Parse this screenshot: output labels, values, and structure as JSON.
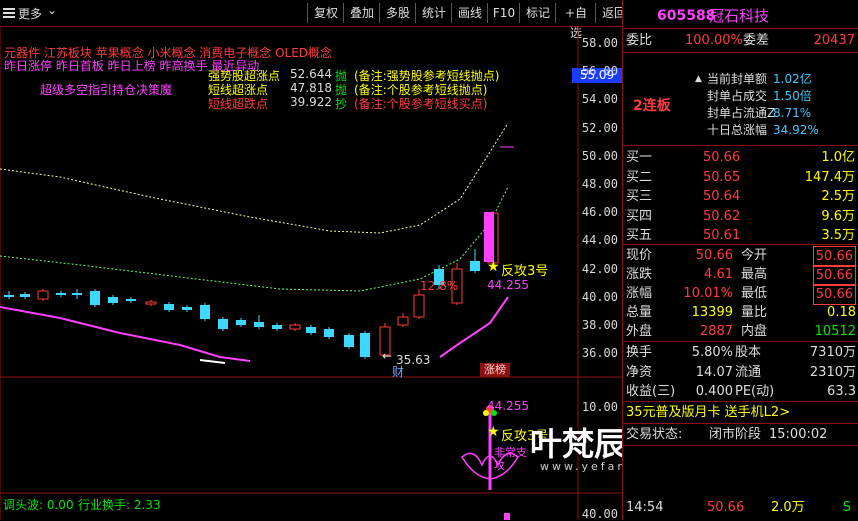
{
  "toolbar": {
    "menu_label": "更多",
    "buttons": [
      "复权",
      "叠加",
      "多股",
      "统计",
      "画线",
      "F10",
      "标记",
      "+自选",
      "返回"
    ]
  },
  "chart": {
    "concepts": "元器件  江苏板块  苹果概念 小米概念 消费电子概念 OLED概念",
    "flags": "昨日涨停 昨日首板 昨日上榜 昨高换手 最近异动",
    "indicator_title": "超级多空指引持仓决策魔",
    "legend": [
      {
        "name": "强势股超涨点",
        "value": "52.644",
        "tag": "抛",
        "note": "(备注:强势股参考短线抛点)",
        "color": "#ffff00"
      },
      {
        "name": "短线超涨点",
        "value": "47.818",
        "tag": "抛",
        "note": "(备注:个股参考短线抛点)",
        "color": "#ffff00"
      },
      {
        "name": "短线超跌点",
        "value": "39.922",
        "tag": "抄",
        "note": "(备注:个股参考短线买点)",
        "color": "#ff3c3c"
      }
    ],
    "y_axis": [
      "58.00",
      "56.00",
      "54.00",
      "52.00",
      "50.00",
      "48.00",
      "46.00",
      "44.00",
      "42.00",
      "40.00",
      "38.00",
      "36.00"
    ],
    "current_price_tag": "55.09",
    "low_marker": "35.63",
    "pct_label": "12.8%",
    "attack_label": "反攻3号",
    "value_label": "44.255",
    "finance_tag": "财",
    "rank_tag": "涨榜",
    "lower_y_axis": [
      "10.00",
      "40.00"
    ],
    "lower_value_label": "44.255",
    "lower_attack_label": "反攻3号",
    "lower_small_1": "非常支",
    "lower_small_2": "攻",
    "footer_left": "调头波: 0.00",
    "footer_right": "行业换手: 2.33",
    "watermark": "叶梵辰指标公式网",
    "watermark_url": "www.yefanchen.com"
  },
  "panel": {
    "code": "605588",
    "name": "冠石科技",
    "weibi_label": "委比",
    "weibi_value": "100.00%",
    "weicha_label": "委差",
    "weicha_value": "20437",
    "board_label": "2连板",
    "seal_stats": [
      {
        "label": "当前封单额",
        "value": "1.02亿"
      },
      {
        "label": "封单占成交",
        "value": "1.50倍"
      },
      {
        "label": "封单占流通Z",
        "value": "8.71%"
      },
      {
        "label": "十日总涨幅",
        "value": "34.92%"
      }
    ],
    "buy": [
      {
        "label": "买一",
        "price": "50.66",
        "vol": "1.0亿"
      },
      {
        "label": "买二",
        "price": "50.65",
        "vol": "147.4万"
      },
      {
        "label": "买三",
        "price": "50.64",
        "vol": "2.5万"
      },
      {
        "label": "买四",
        "price": "50.62",
        "vol": "9.6万"
      },
      {
        "label": "买五",
        "price": "50.61",
        "vol": "3.5万"
      }
    ],
    "quote": [
      {
        "l1": "现价",
        "v1": "50.66",
        "l2": "今开",
        "v2": "50.66"
      },
      {
        "l1": "涨跌",
        "v1": "4.61",
        "l2": "最高",
        "v2": "50.66"
      },
      {
        "l1": "涨幅",
        "v1": "10.01%",
        "l2": "最低",
        "v2": "50.66"
      },
      {
        "l1": "总量",
        "v1": "13399",
        "l2": "量比",
        "v2": "0.18"
      },
      {
        "l1": "外盘",
        "v1": "2887",
        "l2": "内盘",
        "v2": "10512"
      }
    ],
    "stats": [
      {
        "l1": "换手",
        "v1": "5.80%",
        "l2": "股本",
        "v2": "7310万"
      },
      {
        "l1": "净资",
        "v1": "14.07",
        "l2": "流通",
        "v2": "2310万"
      },
      {
        "l1": "收益(三)",
        "v1": "0.400",
        "l2": "PE(动)",
        "v2": "63.3"
      }
    ],
    "promo": "35元普及版月卡 送手机L2>",
    "trade_status_label": "交易状态:",
    "trade_status": "闭市阶段",
    "trade_time": "15:00:02",
    "ticks": [
      {
        "time": "14:54",
        "price": "50.66",
        "vol": "2.0万",
        "side": "S"
      }
    ]
  }
}
